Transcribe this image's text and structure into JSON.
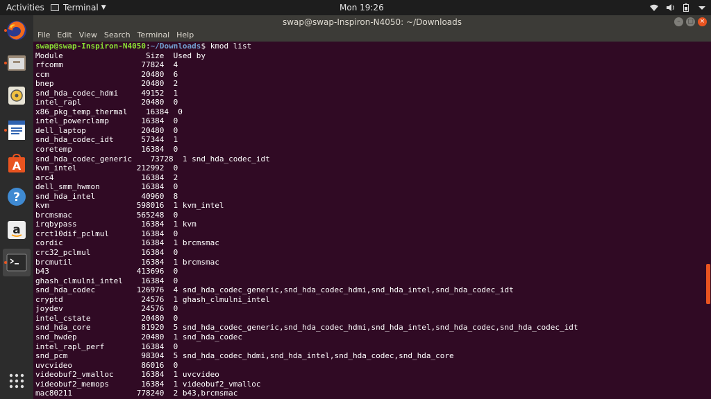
{
  "topbar": {
    "activities": "Activities",
    "app_menu": "Terminal",
    "clock": "Mon 19:26"
  },
  "dock": {
    "items": [
      {
        "name": "firefox",
        "icon": "firefox-icon",
        "running": true
      },
      {
        "name": "files",
        "icon": "files-icon",
        "running": true
      },
      {
        "name": "rhythmbox",
        "icon": "rhythmbox-icon",
        "running": false
      },
      {
        "name": "writer",
        "icon": "writer-icon",
        "running": true
      },
      {
        "name": "software",
        "icon": "software-icon",
        "running": false
      },
      {
        "name": "help",
        "icon": "help-icon",
        "running": false
      },
      {
        "name": "amazon",
        "icon": "amazon-icon",
        "running": false
      },
      {
        "name": "terminal",
        "icon": "terminal-icon",
        "running": true
      }
    ],
    "show_apps": "show-applications-icon",
    "accent": "#e95420"
  },
  "window": {
    "title": "swap@swap-Inspiron-N4050: ~/Downloads",
    "menu": [
      "File",
      "Edit",
      "View",
      "Search",
      "Terminal",
      "Help"
    ]
  },
  "terminal": {
    "prompt_user": "swap@swap-Inspiron-N4050",
    "prompt_path": "~/Downloads",
    "command": "kmod list",
    "scroll_position": 0.7,
    "lines": [
      "Module                  Size  Used by",
      "rfcomm                 77824  4",
      "ccm                    20480  6",
      "bnep                   20480  2",
      "snd_hda_codec_hdmi     49152  1",
      "intel_rapl             20480  0",
      "x86_pkg_temp_thermal    16384  0",
      "intel_powerclamp       16384  0",
      "dell_laptop            20480  0",
      "snd_hda_codec_idt      57344  1",
      "coretemp               16384  0",
      "snd_hda_codec_generic    73728  1 snd_hda_codec_idt",
      "kvm_intel             212992  0",
      "arc4                   16384  2",
      "dell_smm_hwmon         16384  0",
      "snd_hda_intel          40960  8",
      "kvm                   598016  1 kvm_intel",
      "brcmsmac              565248  0",
      "irqbypass              16384  1 kvm",
      "crct10dif_pclmul       16384  0",
      "cordic                 16384  1 brcmsmac",
      "crc32_pclmul           16384  0",
      "brcmutil               16384  1 brcmsmac",
      "b43                   413696  0",
      "ghash_clmulni_intel    16384  0",
      "snd_hda_codec         126976  4 snd_hda_codec_generic,snd_hda_codec_hdmi,snd_hda_intel,snd_hda_codec_idt",
      "cryptd                 24576  1 ghash_clmulni_intel",
      "joydev                 24576  0",
      "intel_cstate           20480  0",
      "snd_hda_core           81920  5 snd_hda_codec_generic,snd_hda_codec_hdmi,snd_hda_intel,snd_hda_codec,snd_hda_codec_idt",
      "snd_hwdep              20480  1 snd_hda_codec",
      "intel_rapl_perf        16384  0",
      "snd_pcm                98304  5 snd_hda_codec_hdmi,snd_hda_intel,snd_hda_codec,snd_hda_core",
      "uvcvideo               86016  0",
      "videobuf2_vmalloc      16384  1 uvcvideo",
      "videobuf2_memops       16384  1 videobuf2_vmalloc",
      "mac80211              778240  2 b43,brcmsmac"
    ]
  }
}
